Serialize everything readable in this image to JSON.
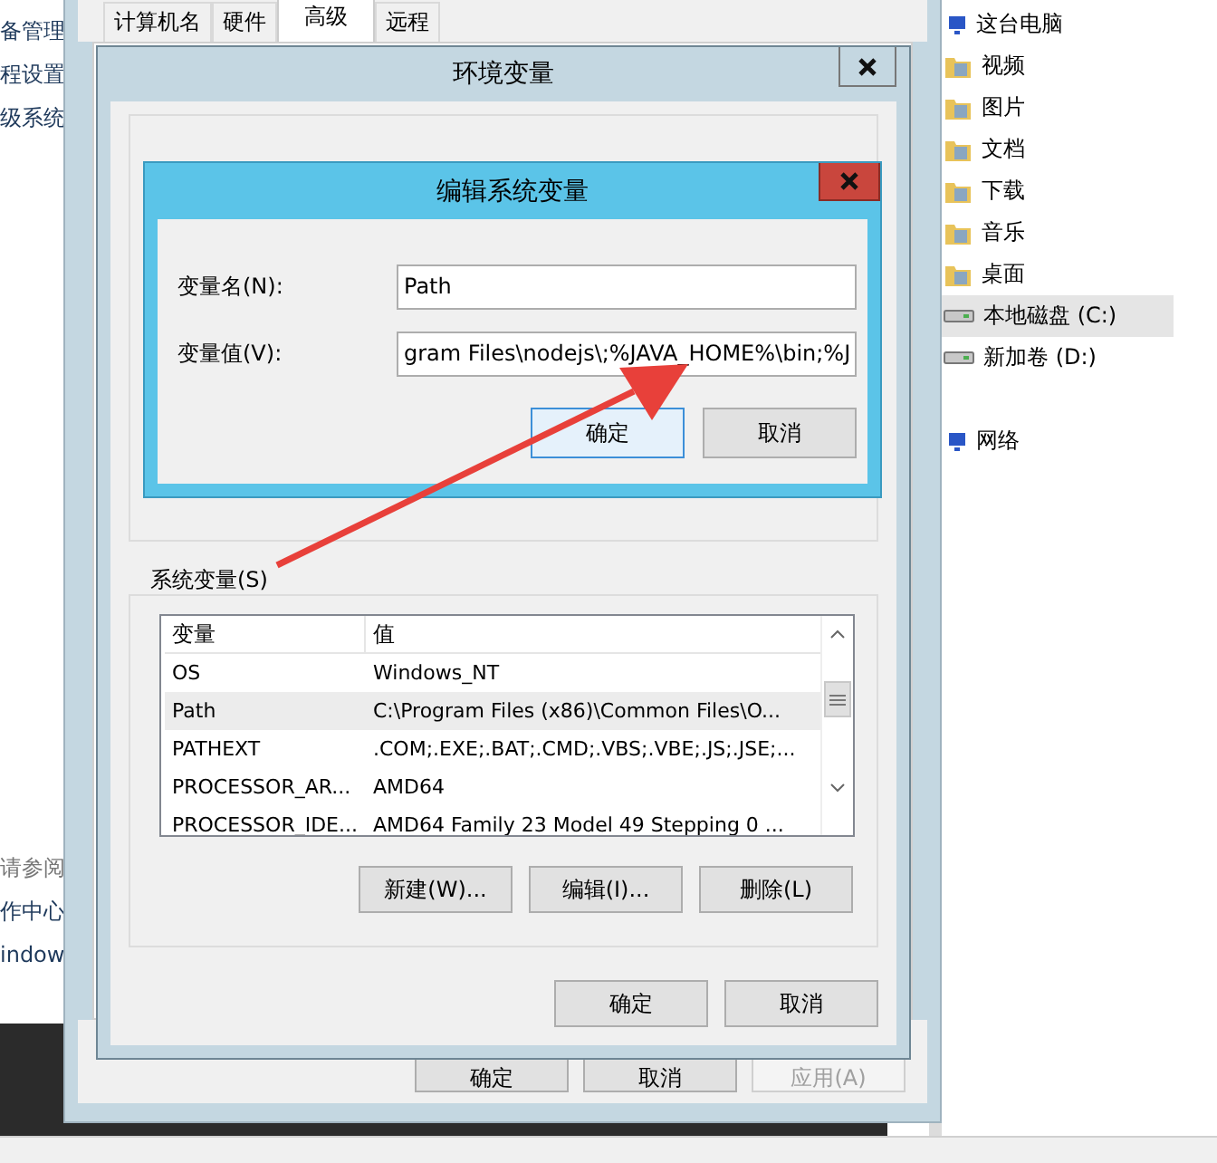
{
  "background_window": {
    "links_top": [
      "备管理",
      "程设置",
      "级系统"
    ],
    "see_also": "请参阅",
    "links_bottom": [
      "作中心",
      "indow"
    ]
  },
  "explorer": {
    "items": [
      {
        "label": "这台电脑",
        "kind": "computer",
        "selected": false
      },
      {
        "label": "视频",
        "kind": "folder",
        "selected": false
      },
      {
        "label": "图片",
        "kind": "folder",
        "selected": false
      },
      {
        "label": "文档",
        "kind": "folder",
        "selected": false
      },
      {
        "label": "下载",
        "kind": "folder",
        "selected": false
      },
      {
        "label": "音乐",
        "kind": "folder",
        "selected": false
      },
      {
        "label": "桌面",
        "kind": "folder",
        "selected": false
      },
      {
        "label": "本地磁盘 (C:)",
        "kind": "drive",
        "selected": true
      },
      {
        "label": "新加卷 (D:)",
        "kind": "drive",
        "selected": false
      },
      {
        "label": "网络",
        "kind": "network",
        "selected": false
      }
    ]
  },
  "system_properties": {
    "tabs": [
      {
        "label": "计算机名",
        "selected": false
      },
      {
        "label": "硬件",
        "selected": false
      },
      {
        "label": "高级",
        "selected": true
      },
      {
        "label": "远程",
        "selected": false
      }
    ],
    "buttons": [
      {
        "label": "确定",
        "disabled": false
      },
      {
        "label": "取消",
        "disabled": false
      },
      {
        "label": "应用(A)",
        "disabled": true
      }
    ]
  },
  "environment_variables": {
    "title": "环境变量",
    "system_group": "系统变量(S)",
    "columns": [
      "变量",
      "值"
    ],
    "rows": [
      {
        "name": "OS",
        "value": "Windows_NT",
        "selected": false
      },
      {
        "name": "Path",
        "value": "C:\\Program Files (x86)\\Common Files\\O...",
        "selected": true
      },
      {
        "name": "PATHEXT",
        "value": ".COM;.EXE;.BAT;.CMD;.VBS;.VBE;.JS;.JSE;...",
        "selected": false
      },
      {
        "name": "PROCESSOR_AR...",
        "value": "AMD64",
        "selected": false
      },
      {
        "name": "PROCESSOR_IDE...",
        "value": "AMD64 Family 23 Model 49 Stepping 0 ...",
        "selected": false
      }
    ],
    "row_buttons": [
      "新建(W)...",
      "编辑(I)...",
      "删除(L)"
    ],
    "buttons": [
      "确定",
      "取消"
    ]
  },
  "edit_dialog": {
    "title": "编辑系统变量",
    "fields": [
      {
        "label": "变量名(N):",
        "value": "Path"
      },
      {
        "label": "变量值(V):",
        "value": "gram Files\\nodejs\\;%JAVA_HOME%\\bin;%J"
      }
    ],
    "buttons": [
      {
        "label": "确定",
        "focused": true
      },
      {
        "label": "取消",
        "focused": false
      }
    ]
  }
}
